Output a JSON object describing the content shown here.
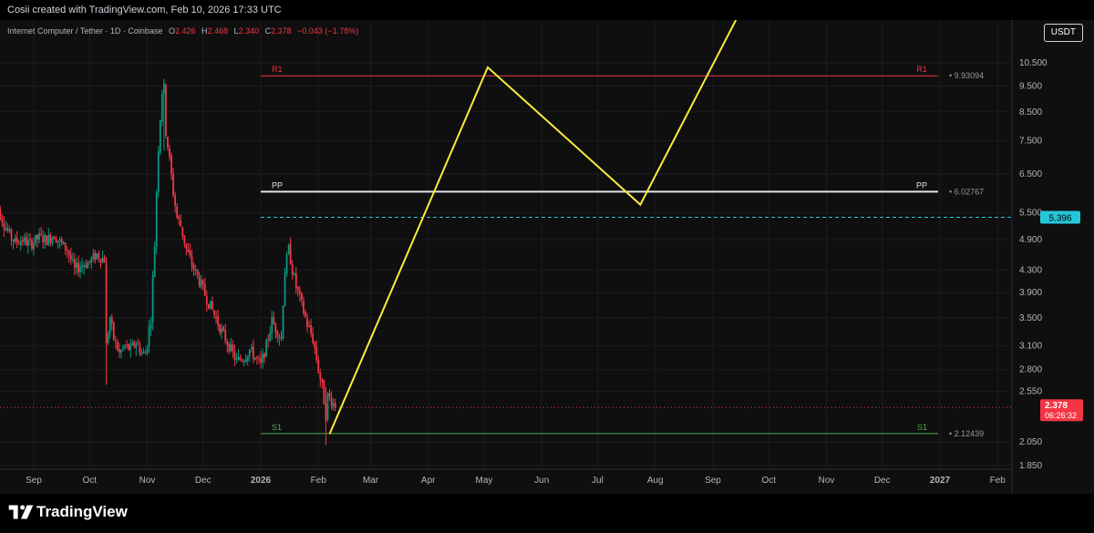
{
  "header": {
    "caption": "Cosii created with TradingView.com, Feb 10, 2026 17:33 UTC"
  },
  "legend": {
    "symbol": "Internet Computer / Tether · 1D · Coinbase",
    "o_key": "O",
    "o_val": "2.426",
    "h_key": "H",
    "h_val": "2.468",
    "l_key": "L",
    "l_val": "2.340",
    "c_key": "C",
    "c_val": "2.378",
    "change": "−0.043 (−1.78%)"
  },
  "currency_button": "USDT",
  "brand": {
    "name": "TradingView"
  },
  "colors": {
    "up": "#089981",
    "down": "#f23645",
    "r1": "#f23645",
    "pp": "#e0e3eb",
    "s1": "#4caf50",
    "projection": "#ffeb3b",
    "dashed": "#26c6da",
    "background": "#0f0f0f"
  },
  "chart_data": {
    "type": "candlestick",
    "symbol": "Internet Computer / Tether",
    "interval": "1D",
    "exchange": "Coinbase",
    "y_scale": "log",
    "ylim": [
      1.75,
      11.3
    ],
    "y_ticks": [
      "10.500",
      "9.500",
      "8.500",
      "7.500",
      "6.500",
      "5.500",
      "4.900",
      "4.300",
      "3.900",
      "3.500",
      "3.100",
      "2.800",
      "2.550",
      "2.050",
      "1.850"
    ],
    "x_ticks": [
      {
        "label": "Sep",
        "date": "2025-09-01",
        "bold": false
      },
      {
        "label": "Oct",
        "date": "2025-10-01",
        "bold": false
      },
      {
        "label": "Nov",
        "date": "2025-11-01",
        "bold": false
      },
      {
        "label": "Dec",
        "date": "2025-12-01",
        "bold": false
      },
      {
        "label": "2026",
        "date": "2026-01-01",
        "bold": true
      },
      {
        "label": "Feb",
        "date": "2026-02-01",
        "bold": false
      },
      {
        "label": "Mar",
        "date": "2026-03-01",
        "bold": false
      },
      {
        "label": "Apr",
        "date": "2026-04-01",
        "bold": false
      },
      {
        "label": "May",
        "date": "2026-05-01",
        "bold": false
      },
      {
        "label": "Jun",
        "date": "2026-06-01",
        "bold": false
      },
      {
        "label": "Jul",
        "date": "2026-07-01",
        "bold": false
      },
      {
        "label": "Aug",
        "date": "2026-08-01",
        "bold": false
      },
      {
        "label": "Sep",
        "date": "2026-09-01",
        "bold": false
      },
      {
        "label": "Oct",
        "date": "2026-10-01",
        "bold": false
      },
      {
        "label": "Nov",
        "date": "2026-11-01",
        "bold": false
      },
      {
        "label": "Dec",
        "date": "2026-12-01",
        "bold": false
      },
      {
        "label": "2027",
        "date": "2027-01-01",
        "bold": true
      },
      {
        "label": "Feb",
        "date": "2027-02-01",
        "bold": false
      }
    ],
    "price_path": [
      [
        "2025-08-11",
        5.4
      ],
      [
        "2025-08-13",
        5.6
      ],
      [
        "2025-08-16",
        5.25
      ],
      [
        "2025-08-19",
        5.0
      ],
      [
        "2025-08-22",
        4.85
      ],
      [
        "2025-08-26",
        4.9
      ],
      [
        "2025-08-30",
        4.8
      ],
      [
        "2025-09-04",
        4.95
      ],
      [
        "2025-09-08",
        4.9
      ],
      [
        "2025-09-12",
        5.0
      ],
      [
        "2025-09-16",
        4.8
      ],
      [
        "2025-09-19",
        4.7
      ],
      [
        "2025-09-23",
        4.3
      ],
      [
        "2025-09-27",
        4.4
      ],
      [
        "2025-10-01",
        4.45
      ],
      [
        "2025-10-05",
        4.6
      ],
      [
        "2025-10-09",
        4.5
      ],
      [
        "2025-10-10",
        3.1
      ],
      [
        "2025-10-12",
        3.5
      ],
      [
        "2025-10-14",
        3.2
      ],
      [
        "2025-10-17",
        3.0
      ],
      [
        "2025-10-20",
        3.1
      ],
      [
        "2025-10-23",
        3.05
      ],
      [
        "2025-10-26",
        3.15
      ],
      [
        "2025-10-29",
        3.0
      ],
      [
        "2025-10-31",
        3.0
      ],
      [
        "2025-11-03",
        3.5
      ],
      [
        "2025-11-05",
        4.8
      ],
      [
        "2025-11-07",
        7.3
      ],
      [
        "2025-11-09",
        9.3
      ],
      [
        "2025-11-10",
        9.4
      ],
      [
        "2025-11-11",
        7.8
      ],
      [
        "2025-11-13",
        6.9
      ],
      [
        "2025-11-15",
        6.0
      ],
      [
        "2025-11-17",
        5.4
      ],
      [
        "2025-11-19",
        5.2
      ],
      [
        "2025-11-22",
        4.7
      ],
      [
        "2025-11-25",
        4.4
      ],
      [
        "2025-11-29",
        4.1
      ],
      [
        "2025-12-03",
        3.8
      ],
      [
        "2025-12-07",
        3.55
      ],
      [
        "2025-12-11",
        3.3
      ],
      [
        "2025-12-15",
        3.1
      ],
      [
        "2025-12-19",
        2.9
      ],
      [
        "2025-12-23",
        2.95
      ],
      [
        "2025-12-26",
        3.05
      ],
      [
        "2025-12-29",
        2.95
      ],
      [
        "2026-01-01",
        2.85
      ],
      [
        "2026-01-04",
        3.1
      ],
      [
        "2026-01-07",
        3.45
      ],
      [
        "2026-01-10",
        3.3
      ],
      [
        "2026-01-12",
        3.2
      ],
      [
        "2026-01-14",
        4.3
      ],
      [
        "2026-01-16",
        4.7
      ],
      [
        "2026-01-18",
        4.3
      ],
      [
        "2026-01-20",
        4.0
      ],
      [
        "2026-01-23",
        3.7
      ],
      [
        "2026-01-26",
        3.4
      ],
      [
        "2026-01-29",
        3.2
      ],
      [
        "2026-02-01",
        2.8
      ],
      [
        "2026-02-03",
        2.6
      ],
      [
        "2026-02-05",
        2.3
      ],
      [
        "2026-02-06",
        2.5
      ],
      [
        "2026-02-08",
        2.45
      ],
      [
        "2026-02-10",
        2.378
      ]
    ],
    "last_candle": {
      "date": "2026-02-10",
      "open": 2.426,
      "high": 2.468,
      "low": 2.34,
      "close": 2.378
    },
    "levels": [
      {
        "label": "R1",
        "value": 9.93094,
        "value_text": "9.93094",
        "from": "2026-01-01",
        "to": "2026-12-31",
        "color": "#f23645"
      },
      {
        "label": "PP",
        "value": 6.02767,
        "value_text": "6.02767",
        "from": "2026-01-01",
        "to": "2026-12-31",
        "color": "#e0e3eb"
      },
      {
        "label": "S1",
        "value": 2.12439,
        "value_text": "2.12439",
        "from": "2026-01-01",
        "to": "2026-12-31",
        "color": "#4caf50"
      }
    ],
    "dashed_level": {
      "value": 5.396,
      "label": "5.396"
    },
    "price_tag": {
      "price": 2.378,
      "price_text": "2.378",
      "countdown": "06:26:32"
    },
    "projection": [
      [
        "2026-02-07",
        2.12
      ],
      [
        "2026-05-03",
        10.3
      ],
      [
        "2026-07-24",
        5.7
      ],
      [
        "2026-09-20",
        14.0
      ]
    ]
  }
}
